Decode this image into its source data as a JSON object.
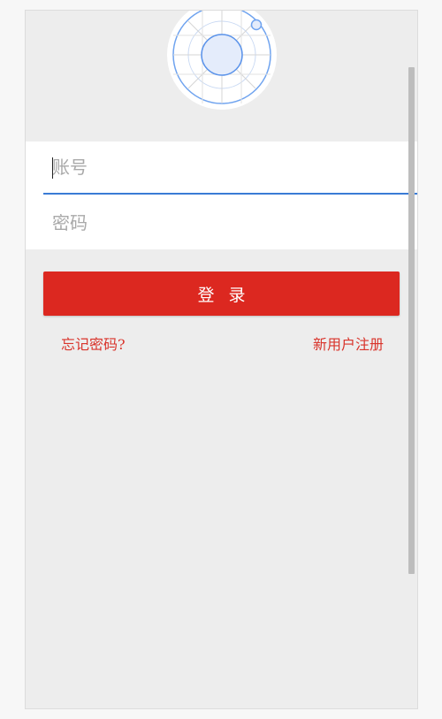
{
  "login_form": {
    "account_placeholder": "账号",
    "password_placeholder": "密码",
    "login_label": "登录",
    "forgot_password_label": "忘记密码?",
    "register_label": "新用户注册"
  },
  "logo": {
    "icon": "app-logo-icon"
  },
  "colors": {
    "primary_button": "#dc2820",
    "link": "#d9342b",
    "focus_underline": "#3a7bd5",
    "background": "#ededed"
  }
}
